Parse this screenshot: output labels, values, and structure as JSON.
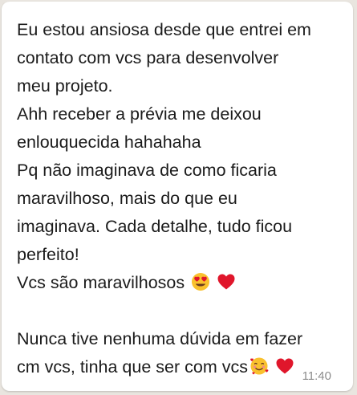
{
  "message": {
    "lines_block1": [
      "Eu estou ansiosa desde que entrei em",
      "contato com vcs para desenvolver",
      "meu projeto.",
      "Ahh receber a prévia me deixou",
      "enlouquecida hahahaha",
      "Pq não imaginava de como ficaria",
      "maravilhoso, mais do que eu",
      "imaginava. Cada detalhe, tudo ficou",
      "perfeito!"
    ],
    "line_vcs": "Vcs são maravilhosos ",
    "line_nunca": "Nunca tive nenhuma dúvida em fazer",
    "line_cm": "cm vcs, tinha que ser com vcs",
    "timestamp": "11:40",
    "emojis": [
      "heart-eyes-emoji",
      "red-heart-emoji",
      "smiling-hearts-emoji",
      "red-heart-emoji"
    ]
  },
  "colors": {
    "bubble": "#ffffff",
    "background": "#e9e5df",
    "text": "#1b1b1b",
    "timestamp": "#8c8c8c",
    "heart": "#e0162b",
    "emoji_face": "#f9c12e"
  }
}
